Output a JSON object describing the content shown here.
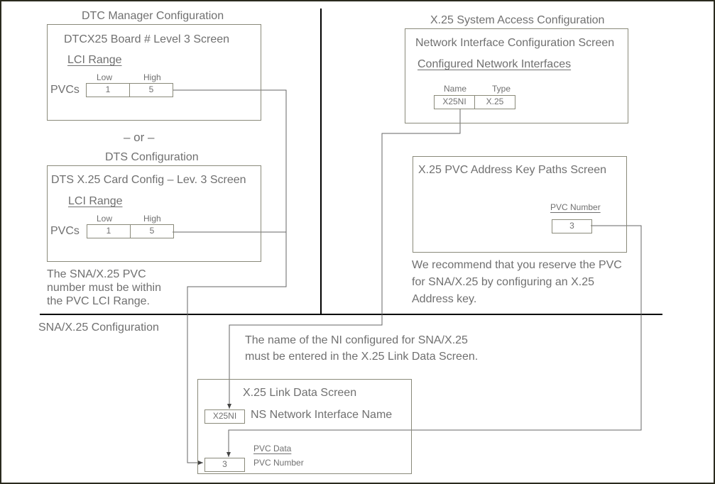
{
  "dtc_manager": {
    "section_title": "DTC Manager Configuration",
    "screen_title": "DTCX25 Board # Level 3 Screen",
    "range_label": "LCI Range",
    "low_header": "Low",
    "high_header": "High",
    "row_label": "PVCs",
    "low_value": "1",
    "high_value": "5"
  },
  "separator_text": "– or –",
  "dts": {
    "section_title": "DTS Configuration",
    "screen_title": "DTS X.25 Card Config – Lev. 3 Screen",
    "range_label": "LCI Range",
    "low_header": "Low",
    "high_header": "High",
    "row_label": "PVCs",
    "low_value": "1",
    "high_value": "5"
  },
  "note_pvc_range": [
    "The SNA/X.25 PVC",
    "number must be within",
    "the PVC LCI Range."
  ],
  "x25_system": {
    "section_title": "X.25 System Access Configuration",
    "screen_title": "Network Interface Configuration Screen",
    "list_label": "Configured Network Interfaces",
    "name_header": "Name",
    "type_header": "Type",
    "name_value": "X25NI",
    "type_value": "X.25"
  },
  "pvc_key": {
    "screen_title": "X.25 PVC Address Key Paths Screen",
    "field_label": "PVC Number",
    "field_value": "3"
  },
  "note_recommend": [
    "We recommend that you reserve the PVC",
    "for SNA/X.25 by configuring an X.25",
    "Address key."
  ],
  "sna": {
    "section_title": "SNA/X.25 Configuration",
    "note": [
      "The name of the NI configured for SNA/X.25",
      "must be entered in the X.25 Link Data Screen."
    ],
    "screen_title": "X.25 Link Data Screen",
    "ni_value": "X25NI",
    "ni_label": "NS Network Interface Name",
    "pvc_group_label": "PVC Data",
    "pvc_value": "3",
    "pvc_label": "PVC Number"
  }
}
